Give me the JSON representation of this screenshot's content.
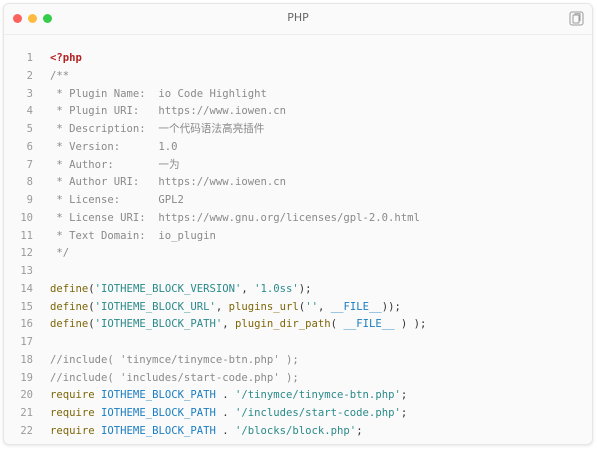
{
  "window": {
    "title": "PHP",
    "copy_icon": "copy-icon"
  },
  "code_lines": [
    {
      "n": "1",
      "tokens": [
        {
          "t": "<?php",
          "k": "tag"
        }
      ]
    },
    {
      "n": "2",
      "tokens": [
        {
          "t": "/**",
          "k": "comment"
        }
      ]
    },
    {
      "n": "3",
      "tokens": [
        {
          "t": " * Plugin Name:  io Code Highlight",
          "k": "comment"
        }
      ]
    },
    {
      "n": "4",
      "tokens": [
        {
          "t": " * Plugin URI:   https://www.iowen.cn",
          "k": "comment"
        }
      ]
    },
    {
      "n": "5",
      "tokens": [
        {
          "t": " * Description:  一个代码语法高亮插件",
          "k": "comment"
        }
      ]
    },
    {
      "n": "6",
      "tokens": [
        {
          "t": " * Version:      1.0",
          "k": "comment"
        }
      ]
    },
    {
      "n": "7",
      "tokens": [
        {
          "t": " * Author:       一为",
          "k": "comment"
        }
      ]
    },
    {
      "n": "8",
      "tokens": [
        {
          "t": " * Author URI:   https://www.iowen.cn",
          "k": "comment"
        }
      ]
    },
    {
      "n": "9",
      "tokens": [
        {
          "t": " * License:      GPL2",
          "k": "comment"
        }
      ]
    },
    {
      "n": "10",
      "tokens": [
        {
          "t": " * License URI:  https://www.gnu.org/licenses/gpl-2.0.html",
          "k": "comment"
        }
      ]
    },
    {
      "n": "11",
      "tokens": [
        {
          "t": " * Text Domain:  io_plugin",
          "k": "comment"
        }
      ]
    },
    {
      "n": "12",
      "tokens": [
        {
          "t": " */",
          "k": "comment"
        }
      ]
    },
    {
      "n": "13",
      "tokens": []
    },
    {
      "n": "14",
      "tokens": [
        {
          "t": "define",
          "k": "func"
        },
        {
          "t": "(",
          "k": "punct"
        },
        {
          "t": "'IOTHEME_BLOCK_VERSION'",
          "k": "string"
        },
        {
          "t": ", ",
          "k": "punct"
        },
        {
          "t": "'1.0ss'",
          "k": "string"
        },
        {
          "t": ");",
          "k": "punct"
        }
      ]
    },
    {
      "n": "15",
      "tokens": [
        {
          "t": "define",
          "k": "func"
        },
        {
          "t": "(",
          "k": "punct"
        },
        {
          "t": "'IOTHEME_BLOCK_URL'",
          "k": "string"
        },
        {
          "t": ", ",
          "k": "punct"
        },
        {
          "t": "plugins_url",
          "k": "func"
        },
        {
          "t": "(",
          "k": "punct"
        },
        {
          "t": "''",
          "k": "string"
        },
        {
          "t": ", ",
          "k": "punct"
        },
        {
          "t": "__FILE__",
          "k": "const"
        },
        {
          "t": "));",
          "k": "punct"
        }
      ]
    },
    {
      "n": "16",
      "tokens": [
        {
          "t": "define",
          "k": "func"
        },
        {
          "t": "(",
          "k": "punct"
        },
        {
          "t": "'IOTHEME_BLOCK_PATH'",
          "k": "string"
        },
        {
          "t": ", ",
          "k": "punct"
        },
        {
          "t": "plugin_dir_path",
          "k": "func"
        },
        {
          "t": "( ",
          "k": "punct"
        },
        {
          "t": "__FILE__",
          "k": "const"
        },
        {
          "t": " ) );",
          "k": "punct"
        }
      ]
    },
    {
      "n": "17",
      "tokens": []
    },
    {
      "n": "18",
      "tokens": [
        {
          "t": "//include( 'tinymce/tinymce-btn.php' );",
          "k": "comment"
        }
      ]
    },
    {
      "n": "19",
      "tokens": [
        {
          "t": "//include( 'includes/start-code.php' );",
          "k": "comment"
        }
      ]
    },
    {
      "n": "20",
      "tokens": [
        {
          "t": "require",
          "k": "keyword"
        },
        {
          "t": " ",
          "k": "punct"
        },
        {
          "t": "IOTHEME_BLOCK_PATH",
          "k": "const"
        },
        {
          "t": " . ",
          "k": "punct"
        },
        {
          "t": "'/tinymce/tinymce-btn.php'",
          "k": "string"
        },
        {
          "t": ";",
          "k": "punct"
        }
      ]
    },
    {
      "n": "21",
      "tokens": [
        {
          "t": "require",
          "k": "keyword"
        },
        {
          "t": " ",
          "k": "punct"
        },
        {
          "t": "IOTHEME_BLOCK_PATH",
          "k": "const"
        },
        {
          "t": " . ",
          "k": "punct"
        },
        {
          "t": "'/includes/start-code.php'",
          "k": "string"
        },
        {
          "t": ";",
          "k": "punct"
        }
      ]
    },
    {
      "n": "22",
      "tokens": [
        {
          "t": "require",
          "k": "keyword"
        },
        {
          "t": " ",
          "k": "punct"
        },
        {
          "t": "IOTHEME_BLOCK_PATH",
          "k": "const"
        },
        {
          "t": " . ",
          "k": "punct"
        },
        {
          "t": "'/blocks/block.php'",
          "k": "string"
        },
        {
          "t": ";",
          "k": "punct"
        }
      ]
    }
  ]
}
